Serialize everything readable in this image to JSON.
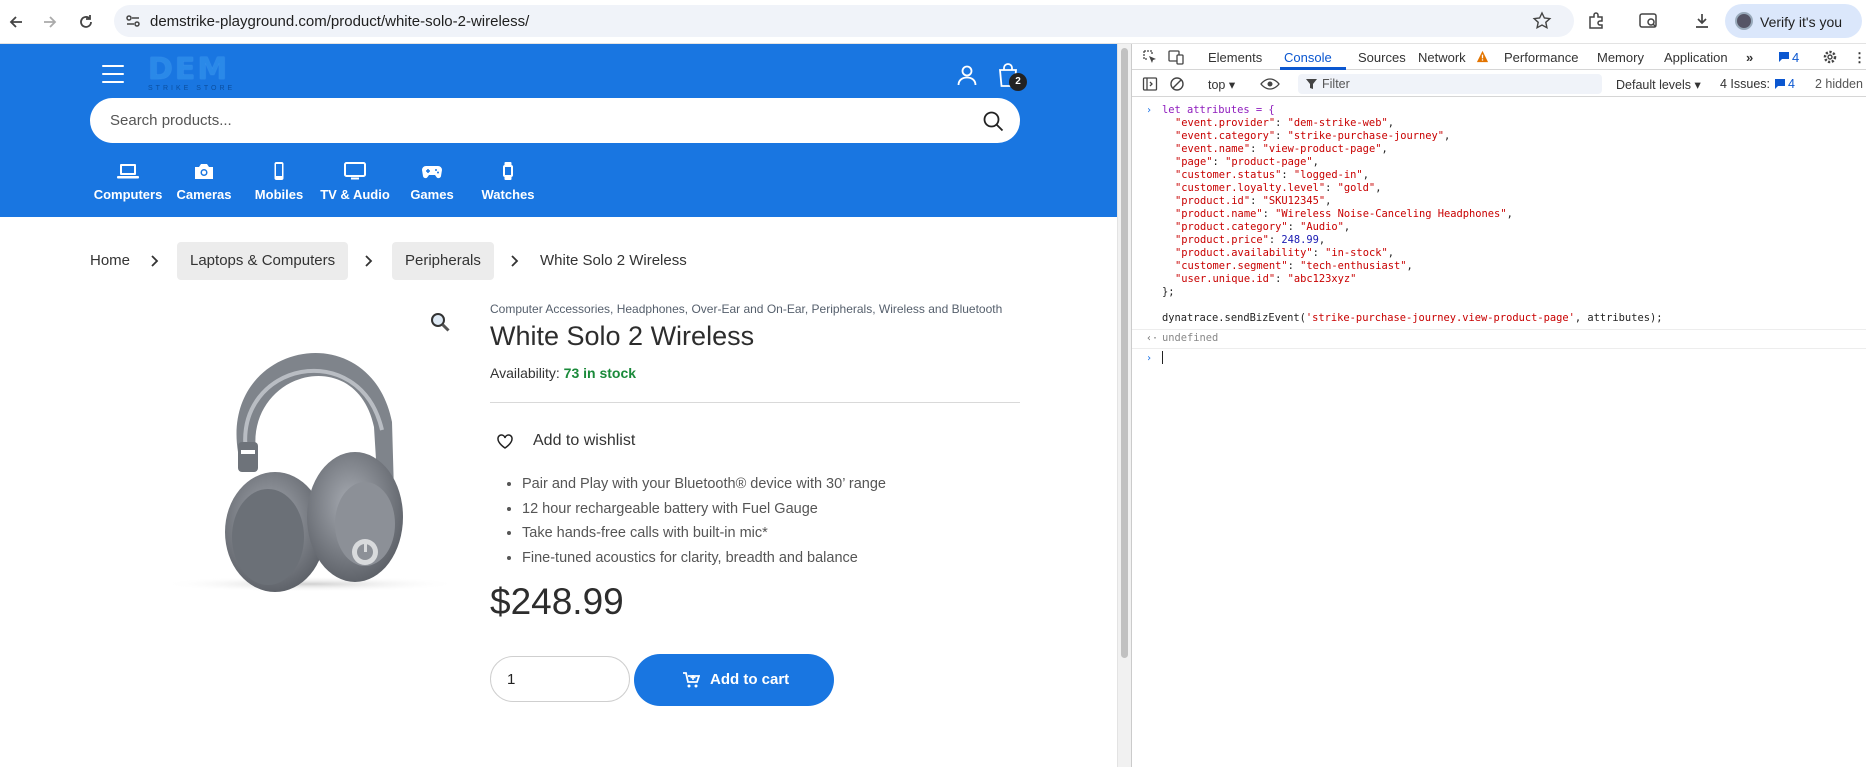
{
  "browser": {
    "url": "demstrike-playground.com/product/white-solo-2-wireless/",
    "verify_label": "Verify it's you"
  },
  "store": {
    "logo_text": "DEM",
    "logo_subtext": "STRIKE STORE",
    "cart_count": "2",
    "search_placeholder": "Search products...",
    "categories": [
      {
        "label": "Computers",
        "icon": "laptop-icon"
      },
      {
        "label": "Cameras",
        "icon": "camera-icon"
      },
      {
        "label": "Mobiles",
        "icon": "phone-icon"
      },
      {
        "label": "TV & Audio",
        "icon": "tv-icon"
      },
      {
        "label": "Games",
        "icon": "gamepad-icon"
      },
      {
        "label": "Watches",
        "icon": "watch-icon"
      }
    ]
  },
  "breadcrumb": [
    "Home",
    "Laptops & Computers",
    "Peripherals",
    "White Solo 2 Wireless"
  ],
  "product": {
    "categories": [
      "Computer Accessories",
      "Headphones",
      "Over-Ear and On-Ear",
      "Peripherals",
      "Wireless and Bluetooth"
    ],
    "title": "White Solo 2 Wireless",
    "availability_label": "Availability:",
    "stock": "73 in stock",
    "wishlist_label": "Add to wishlist",
    "features": [
      "Pair and Play with your Bluetooth® device with 30’ range",
      "12 hour rechargeable battery with Fuel Gauge",
      "Take hands-free calls with built-in mic*",
      "Fine-tuned acoustics for clarity, breadth and balance"
    ],
    "price": "$248.99",
    "quantity": "1",
    "add_to_cart_label": "Add to cart"
  },
  "devtools": {
    "tabs": [
      "Elements",
      "Console",
      "Sources",
      "Network",
      "Performance",
      "Memory",
      "Application"
    ],
    "active_tab": "Console",
    "messages_count": "4",
    "context": "top",
    "filter_placeholder": "Filter",
    "levels": "Default levels",
    "issues_label": "4 Issues:",
    "issues_count": "4",
    "hidden_label": "2 hidden",
    "code_open": "let attributes = {",
    "attributes": [
      {
        "key": "\"event.provider\"",
        "value": "\"dem-strike-web\"",
        "kind": "s"
      },
      {
        "key": "\"event.category\"",
        "value": "\"strike-purchase-journey\"",
        "kind": "s"
      },
      {
        "key": "\"event.name\"",
        "value": "\"view-product-page\"",
        "kind": "s"
      },
      {
        "key": "\"page\"",
        "value": "\"product-page\"",
        "kind": "s"
      },
      {
        "key": "\"customer.status\"",
        "value": "\"logged-in\"",
        "kind": "s"
      },
      {
        "key": "\"customer.loyalty.level\"",
        "value": "\"gold\"",
        "kind": "s"
      },
      {
        "key": "\"product.id\"",
        "value": "\"SKU12345\"",
        "kind": "s"
      },
      {
        "key": "\"product.name\"",
        "value": "\"Wireless Noise-Canceling Headphones\"",
        "kind": "s"
      },
      {
        "key": "\"product.category\"",
        "value": "\"Audio\"",
        "kind": "s"
      },
      {
        "key": "\"product.price\"",
        "value": "248.99",
        "kind": "n"
      },
      {
        "key": "\"product.availability\"",
        "value": "\"in-stock\"",
        "kind": "s"
      },
      {
        "key": "\"customer.segment\"",
        "value": "\"tech-enthusiast\"",
        "kind": "s"
      },
      {
        "key": "\"user.unique.id\"",
        "value": "\"abc123xyz\"",
        "kind": "s"
      }
    ],
    "code_close": "};",
    "call_fn": "dynatrace.sendBizEvent(",
    "call_arg": "'strike-purchase-journey.view-product-page'",
    "call_rest": ", attributes);",
    "result": "undefined"
  }
}
